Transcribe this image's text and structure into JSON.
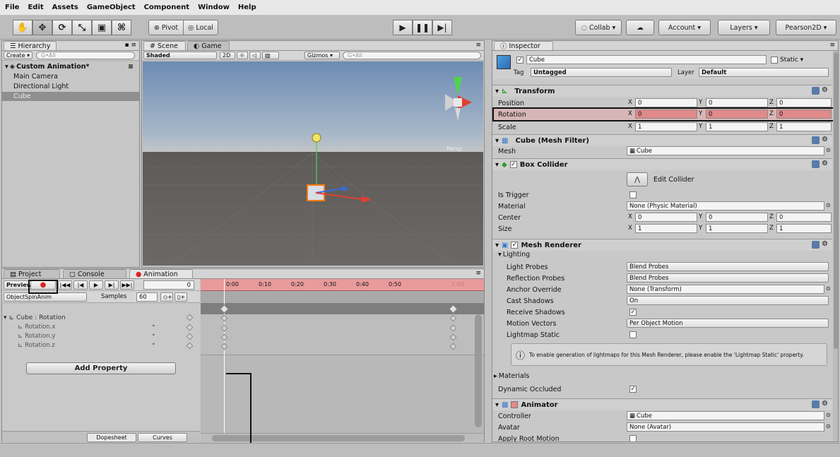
{
  "menu": [
    "File",
    "Edit",
    "Assets",
    "GameObject",
    "Component",
    "Window",
    "Help"
  ],
  "toolbar": {
    "tools": [
      "hand-icon",
      "move-icon",
      "rotate-icon",
      "scale-icon",
      "rect-icon",
      "transform-icon"
    ],
    "pivot": "Pivot",
    "local": "Local",
    "collab": "Collab ▾",
    "account": "Account",
    "layers": "Layers",
    "layout": "Pearson2D"
  },
  "hierarchy": {
    "tab": "Hierarchy",
    "create": "Create ▾",
    "search_placeholder": "G•All",
    "scene": "Custom Animation*",
    "items": [
      "Main Camera",
      "Directional Light",
      "Cube"
    ]
  },
  "scene": {
    "tab_scene": "Scene",
    "tab_game": "Game",
    "shading": "Shaded",
    "mode2d": "2D",
    "gizmos": "Gizmos ▾",
    "search_placeholder": "G•All",
    "persp": "Persp"
  },
  "animation": {
    "tab_project": "Project",
    "tab_console": "Console",
    "tab_animation": "Animation",
    "preview": "Preview",
    "frame": "0",
    "clip": "ObjectSpinAnim",
    "samples_label": "Samples",
    "samples": "60",
    "property_group": "Cube : Rotation",
    "properties": [
      "Rotation.x",
      "Rotation.y",
      "Rotation.z"
    ],
    "add_property": "Add Property",
    "dopesheet": "Dopesheet",
    "curves": "Curves",
    "timeline_ticks": [
      "0:00",
      "0:10",
      "0:20",
      "0:30",
      "0:40",
      "0:50",
      "1:00"
    ]
  },
  "inspector": {
    "tab": "Inspector",
    "object_name": "Cube",
    "static": "Static ▾",
    "tag_label": "Tag",
    "tag": "Untagged",
    "layer_label": "Layer",
    "layer": "Default",
    "transform": {
      "title": "Transform",
      "rows": [
        {
          "label": "Position",
          "x": "0",
          "y": "0",
          "z": "0"
        },
        {
          "label": "Rotation",
          "x": "0",
          "y": "0",
          "z": "0"
        },
        {
          "label": "Scale",
          "x": "1",
          "y": "1",
          "z": "1"
        }
      ]
    },
    "mesh_filter": {
      "title": "Cube (Mesh Filter)",
      "mesh_label": "Mesh",
      "mesh": "Cube"
    },
    "box_collider": {
      "title": "Box Collider",
      "edit": "Edit Collider",
      "is_trigger": "Is Trigger",
      "material_label": "Material",
      "material": "None (Physic Material)",
      "center_label": "Center",
      "center": {
        "x": "0",
        "y": "0",
        "z": "0"
      },
      "size_label": "Size",
      "size": {
        "x": "1",
        "y": "1",
        "z": "1"
      }
    },
    "mesh_renderer": {
      "title": "Mesh Renderer",
      "lighting": "Lighting",
      "rows": [
        {
          "label": "Light Probes",
          "value": "Blend Probes"
        },
        {
          "label": "Reflection Probes",
          "value": "Blend Probes"
        },
        {
          "label": "Anchor Override",
          "value": "None (Transform)"
        },
        {
          "label": "Cast Shadows",
          "value": "On"
        },
        {
          "label": "Receive Shadows",
          "value": ""
        },
        {
          "label": "Motion Vectors",
          "value": "Per Object Motion"
        },
        {
          "label": "Lightmap Static",
          "value": ""
        }
      ],
      "info": "To enable generation of lightmaps for this Mesh Renderer, please enable the 'Lightmap Static' property.",
      "materials": "Materials",
      "dynamic_occluded": "Dynamic Occluded"
    },
    "animator": {
      "title": "Animator",
      "controller_label": "Controller",
      "controller": "Cube",
      "avatar_label": "Avatar",
      "avatar": "None (Avatar)",
      "apply_root": "Apply Root Motion"
    }
  },
  "colors": {
    "record": "#e02020",
    "highlight": "#e08a8a",
    "timeline_red": "#e99a9a"
  }
}
